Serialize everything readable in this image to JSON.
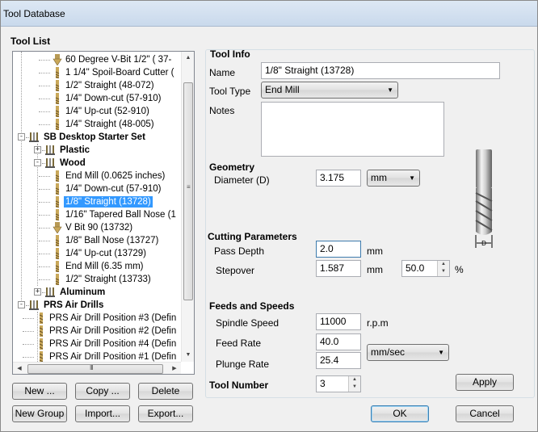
{
  "window": {
    "title": "Tool Database"
  },
  "tool_list": {
    "heading": "Tool List",
    "rows": [
      {
        "label": "60 Degree V-Bit 1/2\"  ( 37-",
        "icon": "vbit-icon",
        "level": 3
      },
      {
        "label": "1 1/4\" Spoil-Board Cutter (",
        "icon": "bit-icon",
        "level": 3
      },
      {
        "label": "1/2\" Straight  (48-072)",
        "icon": "bit-icon",
        "level": 3
      },
      {
        "label": "1/4\"  Down-cut (57-910)",
        "icon": "bit-icon",
        "level": 3
      },
      {
        "label": "1/4\" Up-cut (52-910)",
        "icon": "bit-icon",
        "level": 3
      },
      {
        "label": "1/4\" Straight  (48-005)",
        "icon": "bit-icon",
        "level": 3
      },
      {
        "label": "SB Desktop Starter Set",
        "icon": "group-icon",
        "level": 1,
        "bold": true,
        "expander": "-"
      },
      {
        "label": "Plastic",
        "icon": "group-icon",
        "level": 2,
        "bold": true,
        "expander": "+"
      },
      {
        "label": "Wood",
        "icon": "group-icon",
        "level": 2,
        "bold": true,
        "expander": "-"
      },
      {
        "label": "End Mill (0.0625 inches)",
        "icon": "bit-icon",
        "level": 3
      },
      {
        "label": "1/4\"  Down-cut (57-910)",
        "icon": "bit-icon",
        "level": 3
      },
      {
        "label": "1/8\" Straight (13728)",
        "icon": "bit-icon",
        "level": 3,
        "selected": true
      },
      {
        "label": "1/16\" Tapered Ball Nose (1",
        "icon": "bit-icon",
        "level": 3
      },
      {
        "label": "V Bit 90 (13732)",
        "icon": "vbit-icon",
        "level": 3
      },
      {
        "label": "1/8\" Ball Nose (13727)",
        "icon": "bit-icon",
        "level": 3
      },
      {
        "label": "1/4\" Up-cut (13729)",
        "icon": "bit-icon",
        "level": 3
      },
      {
        "label": "End Mill (6.35 mm)",
        "icon": "bit-icon",
        "level": 3
      },
      {
        "label": "1/2\" Straight (13733)",
        "icon": "bit-icon",
        "level": 3
      },
      {
        "label": "Aluminum",
        "icon": "group-icon",
        "level": 2,
        "bold": true,
        "expander": "+"
      },
      {
        "label": "PRS Air Drills",
        "icon": "group-icon",
        "level": 1,
        "bold": true,
        "expander": "-"
      },
      {
        "label": "PRS Air Drill Position #3 (Defin",
        "icon": "drill-icon",
        "level": 2
      },
      {
        "label": "PRS Air Drill Position #2 (Defin",
        "icon": "drill-icon",
        "level": 2
      },
      {
        "label": "PRS Air Drill Position #4 (Defin",
        "icon": "drill-icon",
        "level": 2
      },
      {
        "label": "PRS Air Drill Position #1 (Defin",
        "icon": "drill-icon",
        "level": 2
      }
    ],
    "buttons": {
      "new": "New ...",
      "copy": "Copy ...",
      "delete": "Delete",
      "new_group": "New Group",
      "import": "Import...",
      "export": "Export..."
    }
  },
  "tool_info": {
    "heading": "Tool Info",
    "name_label": "Name",
    "name_value": "1/8\" Straight (13728)",
    "tool_type_label": "Tool Type",
    "tool_type_value": "End Mill",
    "notes_label": "Notes",
    "notes_value": ""
  },
  "geometry": {
    "heading": "Geometry",
    "diameter_label": "Diameter (D)",
    "diameter_value": "3.175",
    "units_value": "mm"
  },
  "cutting": {
    "heading": "Cutting Parameters",
    "pass_depth_label": "Pass Depth",
    "pass_depth_value": "2.0",
    "pass_depth_unit": "mm",
    "stepover_label": "Stepover",
    "stepover_value": "1.587",
    "stepover_unit": "mm",
    "stepover_percent_value": "50.0",
    "percent_symbol": "%"
  },
  "feeds": {
    "heading": "Feeds and Speeds",
    "spindle_label": "Spindle Speed",
    "spindle_value": "11000",
    "spindle_unit": "r.p.m",
    "feed_label": "Feed Rate",
    "feed_value": "40.0",
    "plunge_label": "Plunge Rate",
    "plunge_value": "25.4",
    "rate_units_value": "mm/sec"
  },
  "tool_number": {
    "label": "Tool Number",
    "value": "3"
  },
  "dialog_buttons": {
    "apply": "Apply",
    "ok": "OK",
    "cancel": "Cancel"
  },
  "diagram": {
    "dimension_letter": "D"
  },
  "scrollbar_glyphs": {
    "up": "▲",
    "down": "▼",
    "left": "◀",
    "right": "▶",
    "grip": "≡",
    "hgrip": "III"
  }
}
